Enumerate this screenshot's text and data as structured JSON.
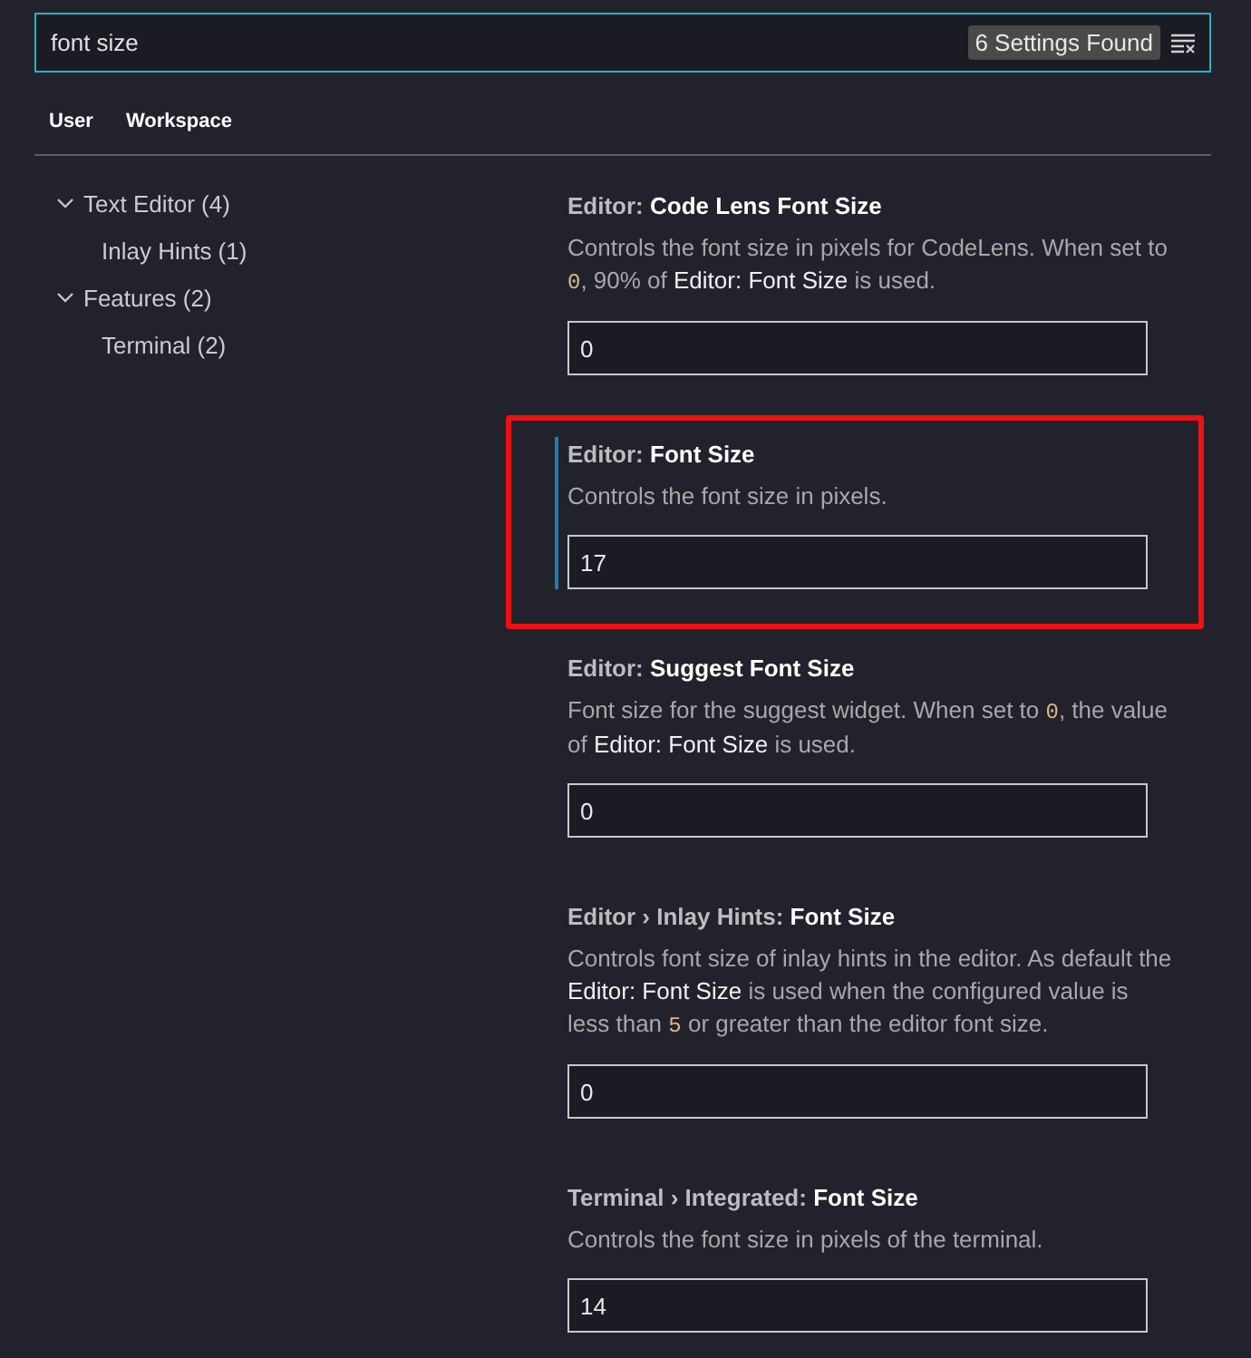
{
  "search": {
    "value": "font size",
    "result_count": "6 Settings Found"
  },
  "tabs": [
    {
      "label": "User"
    },
    {
      "label": "Workspace"
    }
  ],
  "tree": [
    {
      "label": "Text Editor (4)",
      "expanded": true,
      "children": [
        {
          "label": "Inlay Hints (1)"
        }
      ]
    },
    {
      "label": "Features (2)",
      "expanded": true,
      "children": [
        {
          "label": "Terminal (2)"
        }
      ]
    }
  ],
  "settings": [
    {
      "category": "Editor:",
      "name": "Code Lens Font Size",
      "description": [
        {
          "kind": "text",
          "text": "Controls the font size in pixels for CodeLens. When set to "
        },
        {
          "kind": "code",
          "text": "0"
        },
        {
          "kind": "text",
          "text": ", 90% of "
        },
        {
          "kind": "ref",
          "text": "Editor: Font Size"
        },
        {
          "kind": "text",
          "text": " is used."
        }
      ],
      "value": "0",
      "focused": false,
      "annotated": false
    },
    {
      "category": "Editor:",
      "name": "Font Size",
      "description": [
        {
          "kind": "text",
          "text": "Controls the font size in pixels."
        }
      ],
      "value": "17",
      "focused": true,
      "annotated": true
    },
    {
      "category": "Editor:",
      "name": "Suggest Font Size",
      "description": [
        {
          "kind": "text",
          "text": "Font size for the suggest widget. When set to "
        },
        {
          "kind": "code",
          "text": "0"
        },
        {
          "kind": "text",
          "text": ", the value of "
        },
        {
          "kind": "ref",
          "text": "Editor: Font Size"
        },
        {
          "kind": "text",
          "text": " is used."
        }
      ],
      "value": "0",
      "focused": false,
      "annotated": false
    },
    {
      "category": "Editor › Inlay Hints:",
      "name": "Font Size",
      "description": [
        {
          "kind": "text",
          "text": "Controls font size of inlay hints in the editor. As default the "
        },
        {
          "kind": "ref",
          "text": "Editor: Font Size"
        },
        {
          "kind": "text",
          "text": " is used when the configured value is less than "
        },
        {
          "kind": "code",
          "text": "5"
        },
        {
          "kind": "text",
          "text": " or greater than the editor font size."
        }
      ],
      "value": "0",
      "focused": false,
      "annotated": false
    },
    {
      "category": "Terminal › Integrated:",
      "name": "Font Size",
      "description": [
        {
          "kind": "text",
          "text": "Controls the font size in pixels of the terminal."
        }
      ],
      "value": "14",
      "focused": false,
      "annotated": false
    }
  ]
}
